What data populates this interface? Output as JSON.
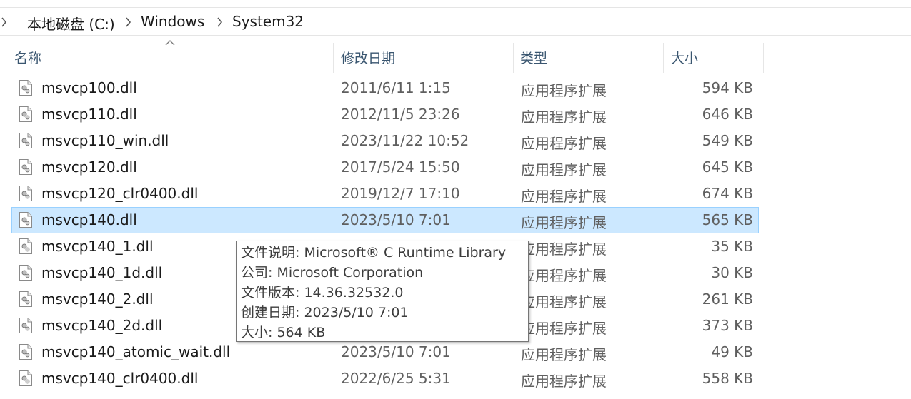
{
  "breadcrumb": {
    "items": [
      "本地磁盘 (C:)",
      "Windows",
      "System32"
    ]
  },
  "columns": {
    "name": "名称",
    "date": "修改日期",
    "type": "类型",
    "size": "大小"
  },
  "files": [
    {
      "name": "msvcp100.dll",
      "date": "2011/6/11 1:15",
      "type": "应用程序扩展",
      "size": "594 KB"
    },
    {
      "name": "msvcp110.dll",
      "date": "2012/11/5 23:26",
      "type": "应用程序扩展",
      "size": "646 KB"
    },
    {
      "name": "msvcp110_win.dll",
      "date": "2023/11/22 10:52",
      "type": "应用程序扩展",
      "size": "549 KB"
    },
    {
      "name": "msvcp120.dll",
      "date": "2017/5/24 15:50",
      "type": "应用程序扩展",
      "size": "645 KB"
    },
    {
      "name": "msvcp120_clr0400.dll",
      "date": "2019/12/7 17:10",
      "type": "应用程序扩展",
      "size": "674 KB"
    },
    {
      "name": "msvcp140.dll",
      "date": "2023/5/10 7:01",
      "type": "应用程序扩展",
      "size": "565 KB",
      "selected": true
    },
    {
      "name": "msvcp140_1.dll",
      "date": "",
      "type": "应用程序扩展",
      "size": "35 KB"
    },
    {
      "name": "msvcp140_1d.dll",
      "date": "",
      "type": "应用程序扩展",
      "size": "30 KB"
    },
    {
      "name": "msvcp140_2.dll",
      "date": "",
      "type": "应用程序扩展",
      "size": "261 KB"
    },
    {
      "name": "msvcp140_2d.dll",
      "date": "",
      "type": "应用程序扩展",
      "size": "373 KB"
    },
    {
      "name": "msvcp140_atomic_wait.dll",
      "date": "2023/5/10 7:01",
      "type": "应用程序扩展",
      "size": "49 KB"
    },
    {
      "name": "msvcp140_clr0400.dll",
      "date": "2022/6/25 5:31",
      "type": "应用程序扩展",
      "size": "558 KB"
    }
  ],
  "tooltip": {
    "lines": [
      "文件说明: Microsoft® C Runtime Library",
      "公司: Microsoft Corporation",
      "文件版本: 14.36.32532.0",
      "创建日期: 2023/5/10 7:01",
      "大小: 564 KB"
    ]
  },
  "icons": {
    "sort": "sort-ascending-icon",
    "file": "dll-file-icon",
    "chevron": "chevron-right-icon"
  },
  "colors": {
    "selection_bg": "#cce8ff",
    "selection_border": "#99d1ff",
    "header_text": "#3a5670"
  }
}
